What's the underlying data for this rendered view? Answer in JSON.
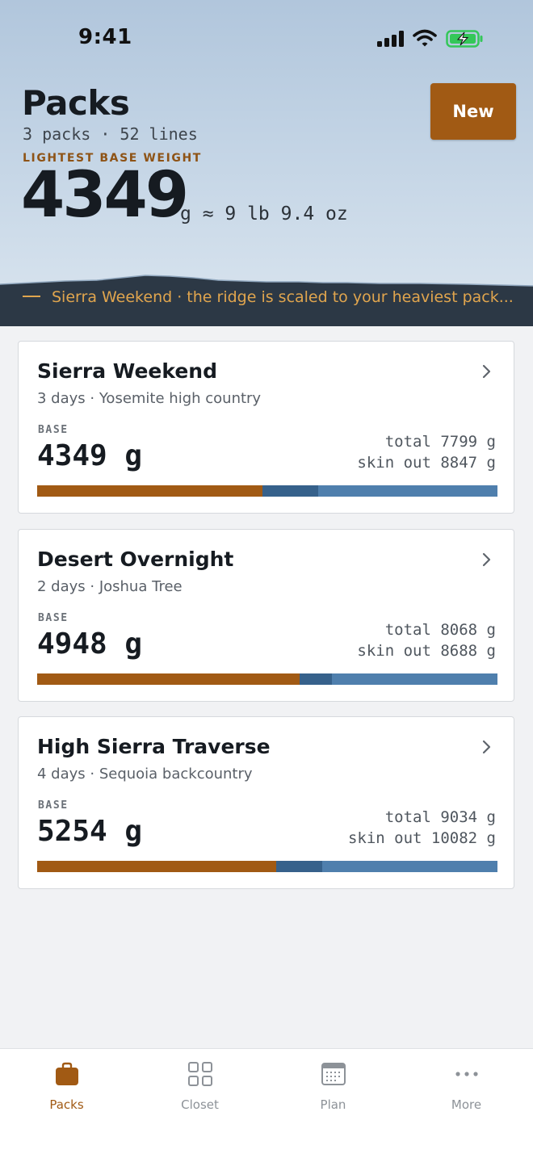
{
  "status": {
    "time": "9:41"
  },
  "header": {
    "title": "Packs",
    "subtitle": "3 packs · 52 lines",
    "kicker": "LIGHTEST BASE WEIGHT",
    "base_weight": "4349",
    "base_weight_unit": "g ≈ 9 lb 9.4 oz",
    "new_button": "New",
    "ridge_caption": "Sierra Weekend · the ridge is scaled to your heaviest pack..."
  },
  "packs": [
    {
      "name": "Sierra Weekend",
      "meta": "3 days · Yosemite high country",
      "base_label": "BASE",
      "base": "4349 g",
      "total": "total 7799 g",
      "skin_out": "skin out 8847 g",
      "breakdown": {
        "base": 0.49,
        "consumable": 0.12,
        "worn": 0.39
      }
    },
    {
      "name": "Desert Overnight",
      "meta": "2 days · Joshua Tree",
      "base_label": "BASE",
      "base": "4948 g",
      "total": "total 8068 g",
      "skin_out": "skin out 8688 g",
      "breakdown": {
        "base": 0.57,
        "consumable": 0.07,
        "worn": 0.36
      }
    },
    {
      "name": "High Sierra Traverse",
      "meta": "4 days · Sequoia backcountry",
      "base_label": "BASE",
      "base": "5254 g",
      "total": "total 9034 g",
      "skin_out": "skin out 10082 g",
      "breakdown": {
        "base": 0.52,
        "consumable": 0.1,
        "worn": 0.38
      }
    }
  ],
  "tabs": [
    {
      "label": "Packs",
      "icon": "bag-icon",
      "active": true
    },
    {
      "label": "Closet",
      "icon": "grid-icon",
      "active": false
    },
    {
      "label": "Plan",
      "icon": "calendar-icon",
      "active": false
    },
    {
      "label": "More",
      "icon": "more-icon",
      "active": false
    }
  ],
  "colors": {
    "accent": "#a15a14",
    "base_bar": "#a15a14",
    "consumable_bar": "#36618b",
    "worn_bar": "#4f7fad",
    "ridge": "#2c3845",
    "ridge_caption": "#e0a54e"
  }
}
